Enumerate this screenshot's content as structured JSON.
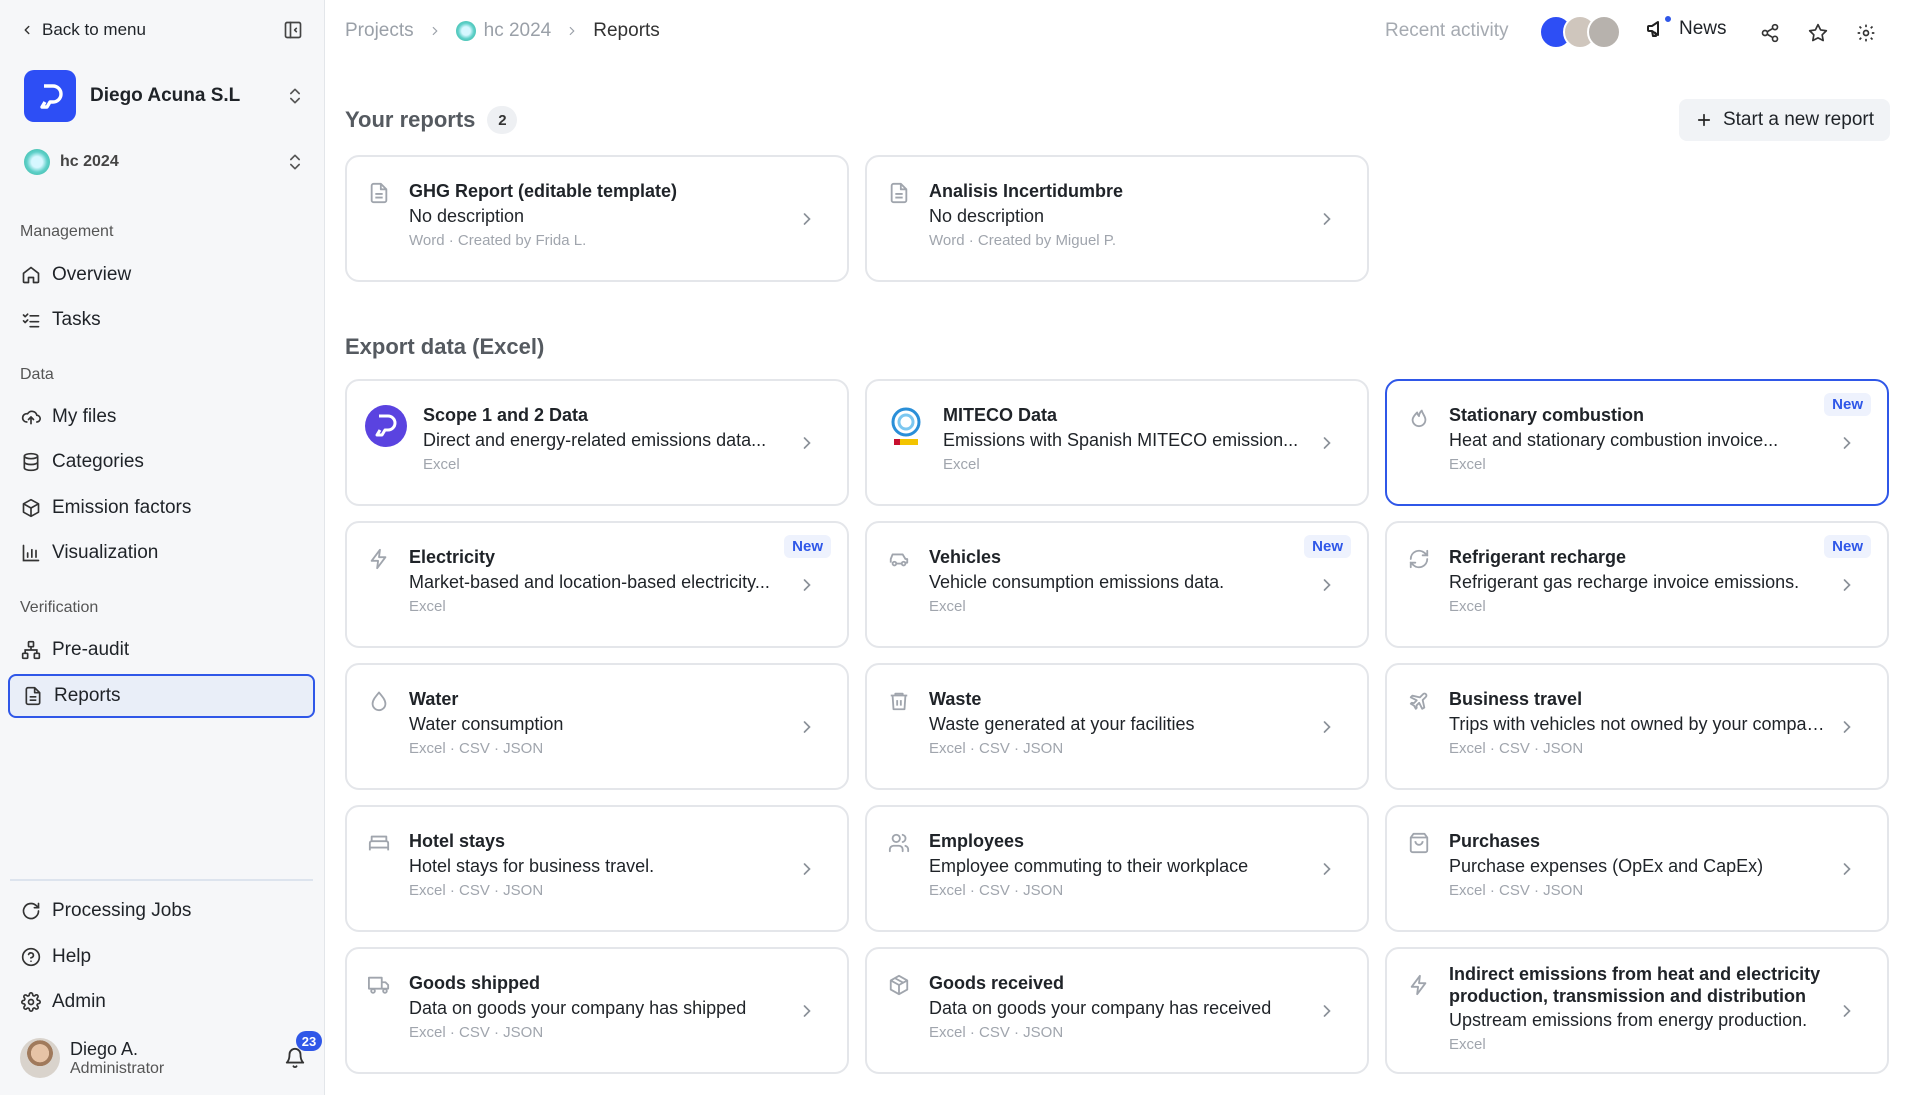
{
  "sidebar": {
    "back_label": "Back to menu",
    "org_name": "Diego Acuna S.L",
    "project_name": "hc 2024",
    "sections": {
      "management": "Management",
      "data": "Data",
      "verification": "Verification"
    },
    "items": {
      "overview": "Overview",
      "tasks": "Tasks",
      "my_files": "My files",
      "categories": "Categories",
      "emission_factors": "Emission factors",
      "visualization": "Visualization",
      "pre_audit": "Pre-audit",
      "reports": "Reports",
      "processing_jobs": "Processing Jobs",
      "help": "Help",
      "admin": "Admin"
    },
    "user": {
      "name": "Diego A.",
      "role": "Administrator",
      "notifications": "23"
    }
  },
  "topbar": {
    "breadcrumb": {
      "projects": "Projects",
      "project": "hc 2024",
      "current": "Reports"
    },
    "recent_activity": "Recent activity",
    "news_label": "News"
  },
  "reports": {
    "heading": "Your reports",
    "count": "2",
    "new_report_label": "Start a new report",
    "items": [
      {
        "title": "GHG Report (editable template)",
        "desc": "No description",
        "meta": "Word · Created by Frida L."
      },
      {
        "title": "Analisis Incertidumbre",
        "desc": "No description",
        "meta": "Word · Created by Miguel P."
      }
    ]
  },
  "export": {
    "heading": "Export data (Excel)",
    "new_label": "New",
    "items": [
      {
        "title": "Scope 1 and 2 Data",
        "desc": "Direct and energy-related emissions data...",
        "meta": "Excel"
      },
      {
        "title": "MITECO Data",
        "desc": "Emissions with Spanish MITECO emission...",
        "meta": "Excel"
      },
      {
        "title": "Stationary combustion",
        "desc": "Heat and stationary combustion invoice...",
        "meta": "Excel"
      },
      {
        "title": "Electricity",
        "desc": "Market-based and location-based electricity...",
        "meta": "Excel"
      },
      {
        "title": "Vehicles",
        "desc": "Vehicle consumption emissions data.",
        "meta": "Excel"
      },
      {
        "title": "Refrigerant recharge",
        "desc": "Refrigerant gas recharge invoice emissions.",
        "meta": "Excel"
      },
      {
        "title": "Water",
        "desc": "Water consumption",
        "meta": "Excel · CSV · JSON"
      },
      {
        "title": "Waste",
        "desc": "Waste generated at your facilities",
        "meta": "Excel · CSV · JSON"
      },
      {
        "title": "Business travel",
        "desc": "Trips with vehicles not owned by your company.",
        "meta": "Excel · CSV · JSON"
      },
      {
        "title": "Hotel stays",
        "desc": "Hotel stays for business travel.",
        "meta": "Excel · CSV · JSON"
      },
      {
        "title": "Employees",
        "desc": "Employee commuting to their workplace",
        "meta": "Excel · CSV · JSON"
      },
      {
        "title": "Purchases",
        "desc": "Purchase expenses (OpEx and CapEx)",
        "meta": "Excel · CSV · JSON"
      },
      {
        "title": "Goods shipped",
        "desc": "Data on goods your company has shipped",
        "meta": "Excel · CSV · JSON"
      },
      {
        "title": "Goods received",
        "desc": "Data on goods your company has received",
        "meta": "Excel · CSV · JSON"
      },
      {
        "title": "Indirect emissions from heat and electricity production, transmission and distribution",
        "desc": "Upstream emissions from energy production.",
        "meta": "Excel"
      }
    ]
  },
  "colors": {
    "accent": "#2f57e8",
    "brand": "#2d4ef5",
    "sidebar_bg": "#f6f7f9"
  }
}
